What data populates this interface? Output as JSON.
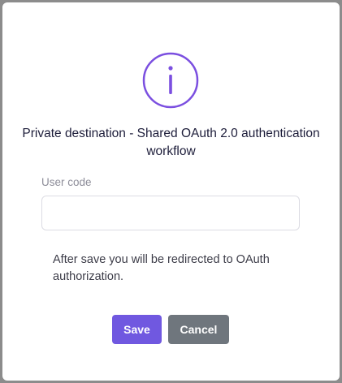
{
  "dialog": {
    "icon": "info-icon",
    "title": "Private destination - Shared OAuth 2.0 authentication workflow",
    "accent_color": "#7b4fe0",
    "field": {
      "label": "User code",
      "value": "",
      "placeholder": ""
    },
    "note": "After save you will be redirected to OAuth authorization.",
    "buttons": {
      "save_label": "Save",
      "save_color": "#7058e0",
      "cancel_label": "Cancel",
      "cancel_color": "#6f767d"
    }
  }
}
